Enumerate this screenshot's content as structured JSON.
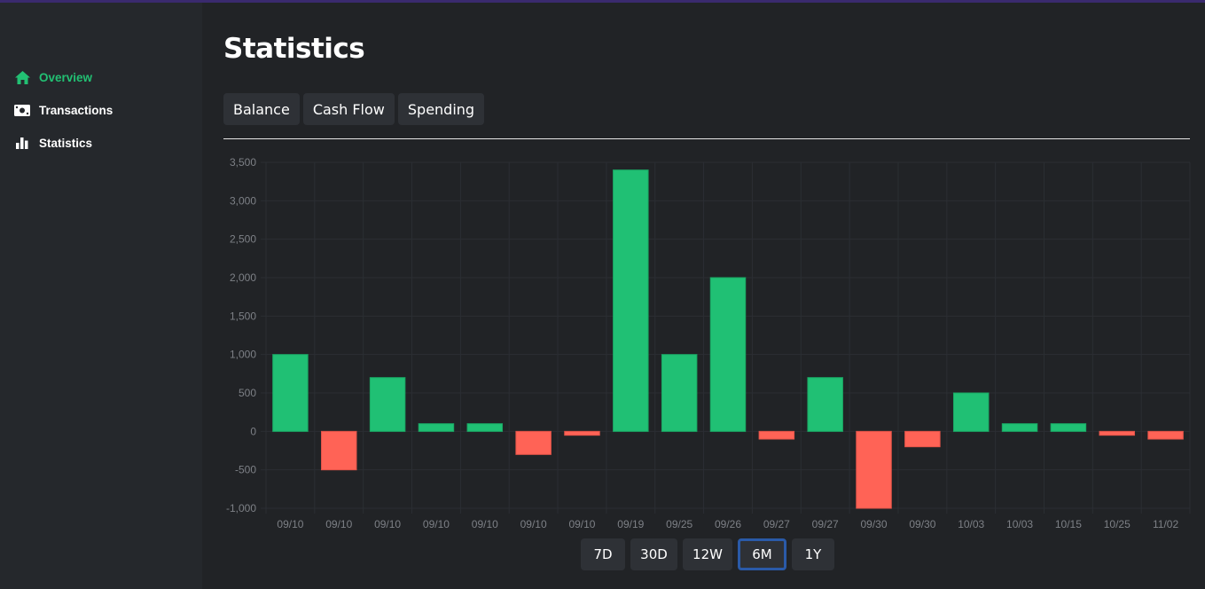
{
  "colors": {
    "accent": "#22c073",
    "positive": "#20c074",
    "negative": "#ff6356",
    "background": "#212326",
    "sidebar": "#25282c",
    "selected_border": "#2a5aa8"
  },
  "sidebar": {
    "items": [
      {
        "label": "Overview",
        "icon": "home-icon",
        "active": true
      },
      {
        "label": "Transactions",
        "icon": "money-icon",
        "active": false
      },
      {
        "label": "Statistics",
        "icon": "bar-chart-icon",
        "active": false
      }
    ]
  },
  "main": {
    "title": "Statistics",
    "tabs": [
      {
        "label": "Balance"
      },
      {
        "label": "Cash Flow"
      },
      {
        "label": "Spending"
      }
    ],
    "ranges": [
      {
        "label": "7D",
        "selected": false
      },
      {
        "label": "30D",
        "selected": false
      },
      {
        "label": "12W",
        "selected": false
      },
      {
        "label": "6M",
        "selected": true
      },
      {
        "label": "1Y",
        "selected": false
      }
    ]
  },
  "chart_data": {
    "type": "bar",
    "categories": [
      "09/10",
      "09/10",
      "09/10",
      "09/10",
      "09/10",
      "09/10",
      "09/10",
      "09/19",
      "09/25",
      "09/26",
      "09/27",
      "09/27",
      "09/30",
      "09/30",
      "10/03",
      "10/03",
      "10/15",
      "10/25",
      "11/02"
    ],
    "values": [
      1000,
      -500,
      700,
      100,
      100,
      -300,
      -50,
      3400,
      1000,
      2000,
      -100,
      700,
      -1000,
      -200,
      500,
      100,
      100,
      -50,
      -100
    ],
    "ylim": [
      -1000,
      3500
    ],
    "yticks": [
      "3,500",
      "3,000",
      "2,500",
      "2,000",
      "1,500",
      "1,000",
      "500",
      "0",
      "-500",
      "-1,000"
    ],
    "grid": true,
    "title": "",
    "xlabel": "",
    "ylabel": ""
  }
}
